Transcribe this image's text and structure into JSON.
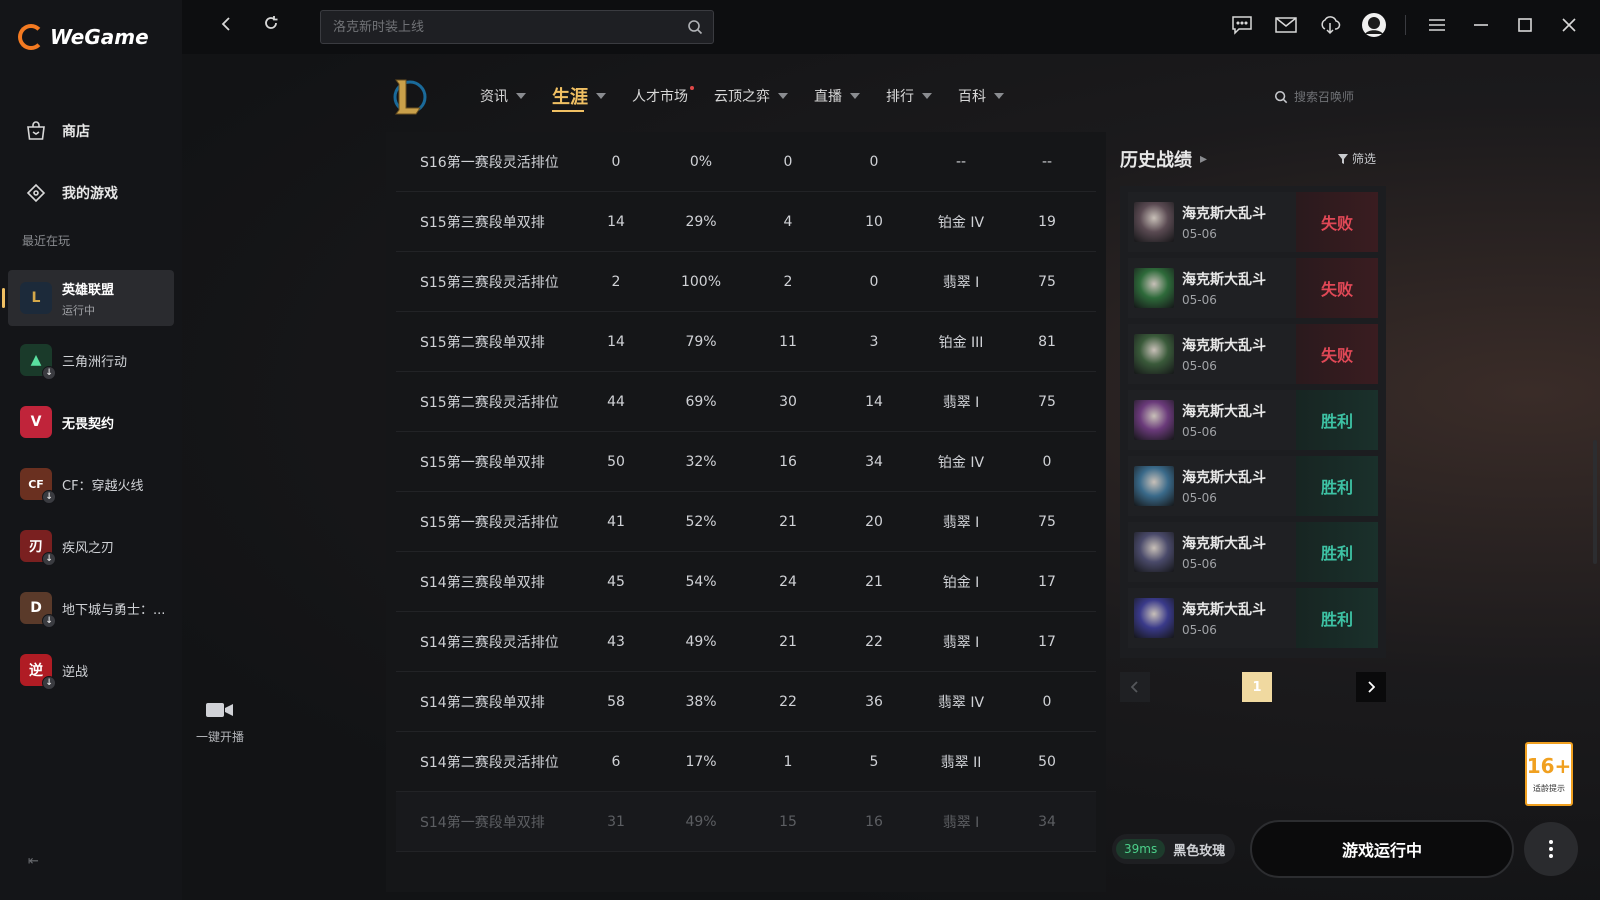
{
  "app": {
    "name": "WeGame"
  },
  "sidebar": {
    "nav": [
      {
        "label": "商店",
        "icon": "shop-bag-icon"
      },
      {
        "label": "我的游戏",
        "icon": "game-controller-icon"
      }
    ],
    "recent_label": "最近在玩",
    "recent": [
      {
        "name": "英雄联盟",
        "sub": "运行中",
        "active": true,
        "color": "#1c2a3a",
        "glyph": "L"
      },
      {
        "name": "三角洲行动",
        "sub": "",
        "color": "#1a3a2a",
        "glyph": "▲"
      },
      {
        "name": "无畏契约",
        "sub": "",
        "color": "#c0243a",
        "glyph": "V"
      },
      {
        "name": "CF：穿越火线",
        "sub": "",
        "color": "#6a3020",
        "glyph": "CF"
      },
      {
        "name": "疾风之刃",
        "sub": "",
        "color": "#7a2020",
        "glyph": "刃"
      },
      {
        "name": "地下城与勇士：...",
        "sub": "",
        "color": "#5a3a2a",
        "glyph": "D"
      },
      {
        "name": "逆战",
        "sub": "",
        "color": "#b01c24",
        "glyph": "逆"
      }
    ]
  },
  "topbar": {
    "search_placeholder": "洛克新时装上线"
  },
  "game_nav": {
    "tabs": [
      {
        "label": "资讯",
        "caret": true
      },
      {
        "label": "生涯",
        "caret": true,
        "active": true
      },
      {
        "label": "人才市场",
        "caret": false,
        "dot": true
      },
      {
        "label": "云顶之弈",
        "caret": true
      },
      {
        "label": "直播",
        "caret": true
      },
      {
        "label": "排行",
        "caret": true
      },
      {
        "label": "百科",
        "caret": true
      }
    ],
    "summoner_search": "搜索召唤师"
  },
  "ranked_table": {
    "rows": [
      [
        "S16第一赛段灵活排位",
        "0",
        "0%",
        "0",
        "0",
        "--",
        "--"
      ],
      [
        "S15第三赛段单双排",
        "14",
        "29%",
        "4",
        "10",
        "铂金 IV",
        "19"
      ],
      [
        "S15第三赛段灵活排位",
        "2",
        "100%",
        "2",
        "0",
        "翡翠 I",
        "75"
      ],
      [
        "S15第二赛段单双排",
        "14",
        "79%",
        "11",
        "3",
        "铂金 III",
        "81"
      ],
      [
        "S15第二赛段灵活排位",
        "44",
        "69%",
        "30",
        "14",
        "翡翠 I",
        "75"
      ],
      [
        "S15第一赛段单双排",
        "50",
        "32%",
        "16",
        "34",
        "铂金 IV",
        "0"
      ],
      [
        "S15第一赛段灵活排位",
        "41",
        "52%",
        "21",
        "20",
        "翡翠 I",
        "75"
      ],
      [
        "S14第三赛段单双排",
        "45",
        "54%",
        "24",
        "21",
        "铂金 I",
        "17"
      ],
      [
        "S14第三赛段灵活排位",
        "43",
        "49%",
        "21",
        "22",
        "翡翠 I",
        "17"
      ],
      [
        "S14第二赛段单双排",
        "58",
        "38%",
        "22",
        "36",
        "翡翠 IV",
        "0"
      ],
      [
        "S14第二赛段灵活排位",
        "6",
        "17%",
        "1",
        "5",
        "翡翠 II",
        "50"
      ],
      [
        "S14第一赛段单双排",
        "31",
        "49%",
        "15",
        "16",
        "翡翠 I",
        "34"
      ]
    ]
  },
  "history": {
    "title": "历史战绩",
    "filter_label": "筛选",
    "matches": [
      {
        "mode": "海克斯大乱斗",
        "date": "05-06",
        "result": "失败",
        "win": false,
        "champ_color": "#5a4a52"
      },
      {
        "mode": "海克斯大乱斗",
        "date": "05-06",
        "result": "失败",
        "win": false,
        "champ_color": "#2e6a3a"
      },
      {
        "mode": "海克斯大乱斗",
        "date": "05-06",
        "result": "失败",
        "win": false,
        "champ_color": "#3a5a3a"
      },
      {
        "mode": "海克斯大乱斗",
        "date": "05-06",
        "result": "胜利",
        "win": true,
        "champ_color": "#6a3a7a"
      },
      {
        "mode": "海克斯大乱斗",
        "date": "05-06",
        "result": "胜利",
        "win": true,
        "champ_color": "#3a6a8a"
      },
      {
        "mode": "海克斯大乱斗",
        "date": "05-06",
        "result": "胜利",
        "win": true,
        "champ_color": "#4a4a6a"
      },
      {
        "mode": "海克斯大乱斗",
        "date": "05-06",
        "result": "胜利",
        "win": true,
        "champ_color": "#3a3a8a"
      }
    ],
    "page": "1"
  },
  "live": {
    "label": "一键开播"
  },
  "status": {
    "ping": "39ms",
    "server": "黑色玫瑰"
  },
  "play_button": "游戏运行中",
  "age_rating": {
    "number": "16+",
    "text": "适龄提示"
  }
}
